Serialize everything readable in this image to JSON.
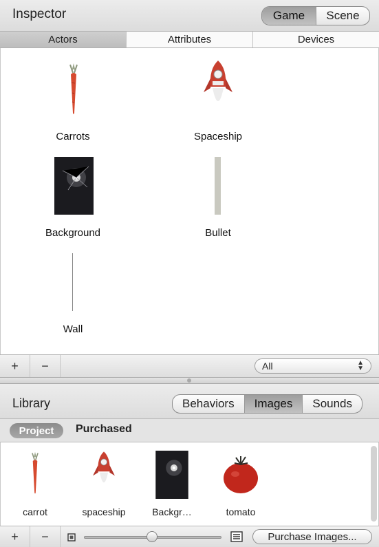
{
  "inspector": {
    "title": "Inspector",
    "mode_toggle": [
      "Game",
      "Scene"
    ],
    "mode_selected": "Game",
    "tabs": [
      "Actors",
      "Attributes",
      "Devices"
    ],
    "selected_tab": "Actors",
    "actors": [
      {
        "label": "Carrots",
        "icon": "carrot-icon"
      },
      {
        "label": "Spaceship",
        "icon": "rocket-icon"
      },
      {
        "label": "Background",
        "icon": "starfield-icon"
      },
      {
        "label": "Bullet",
        "icon": "bullet-bar-icon"
      },
      {
        "label": "Wall",
        "icon": "wall-line-icon"
      }
    ],
    "add_label": "+",
    "remove_label": "−",
    "filter": {
      "value": "All"
    }
  },
  "library": {
    "title": "Library",
    "tabs": [
      "Behaviors",
      "Images",
      "Sounds"
    ],
    "selected_tab": "Images",
    "sources": [
      "Project",
      "Purchased"
    ],
    "selected_source": "Project",
    "images": [
      {
        "label": "carrot",
        "icon": "carrot-icon"
      },
      {
        "label": "spaceship",
        "icon": "rocket-icon"
      },
      {
        "label": "Backgr…",
        "icon": "starfield-icon"
      },
      {
        "label": "tomato",
        "icon": "tomato-icon"
      }
    ],
    "add_label": "+",
    "remove_label": "−",
    "purchase_button": "Purchase Images..."
  },
  "colors": {
    "accent_red": "#c0392b",
    "selected_segment": "#a9a9a9"
  }
}
